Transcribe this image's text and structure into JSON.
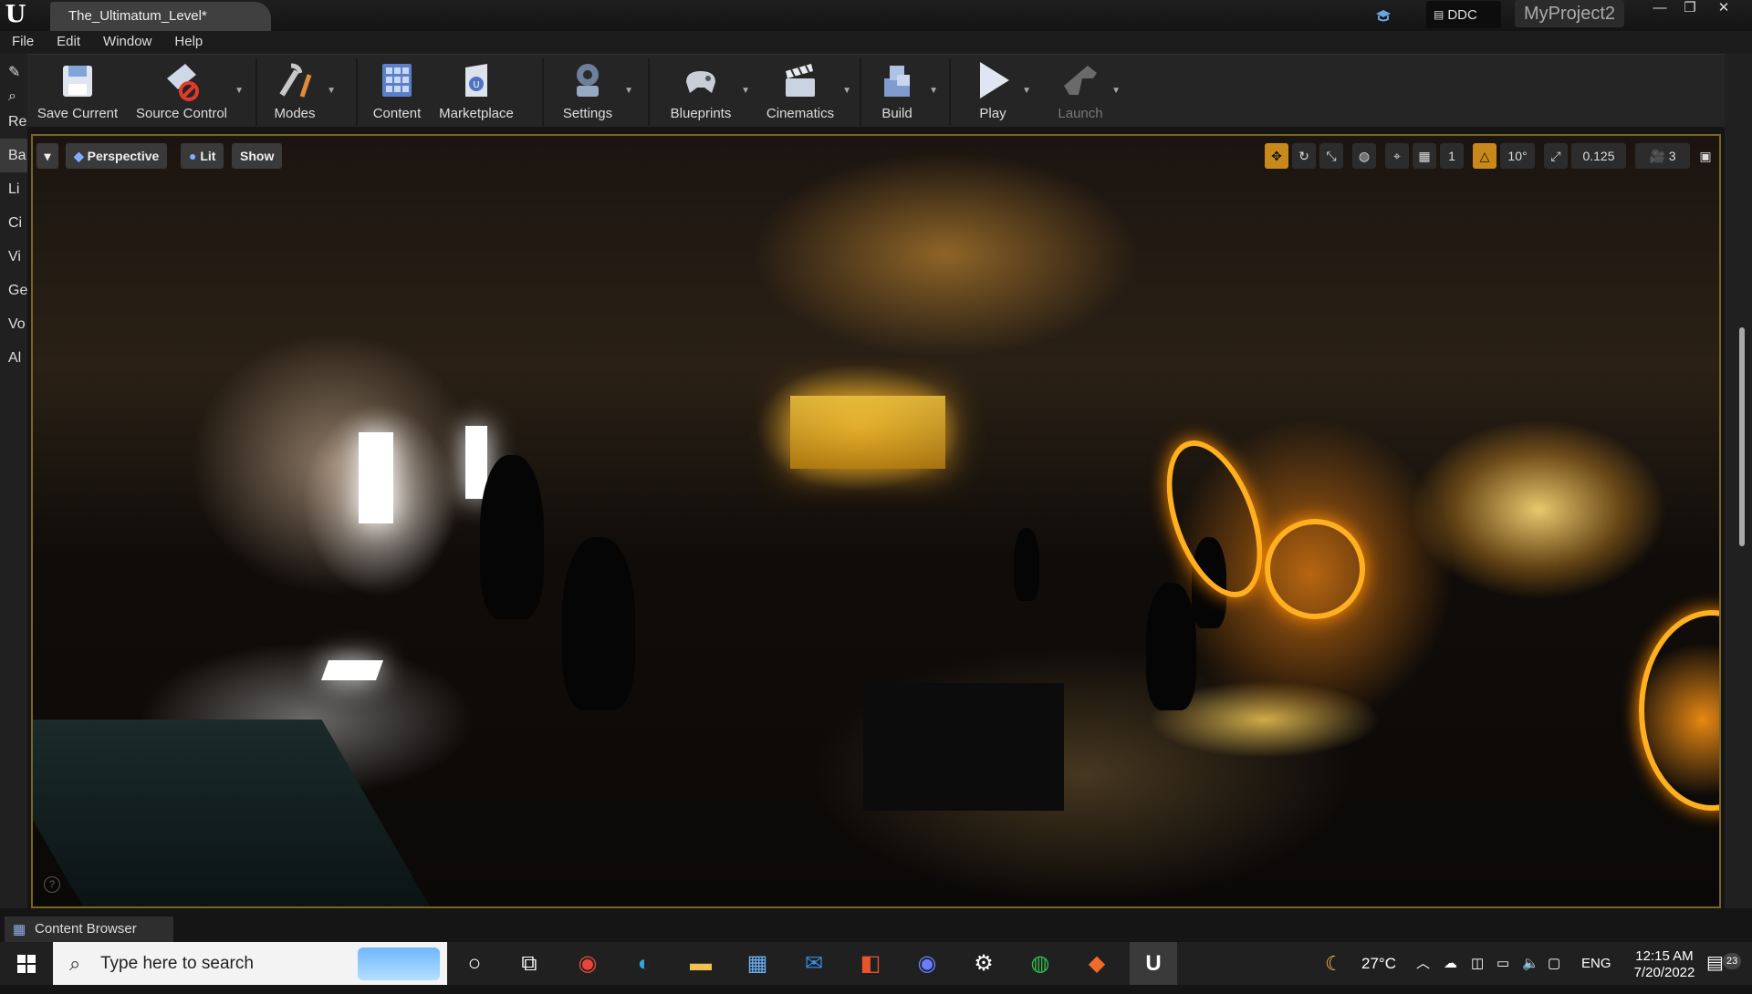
{
  "window": {
    "logo": "U",
    "tab_title": "The_Ultimatum_Level*",
    "ddc_label": "DDC",
    "project_name": "MyProject2"
  },
  "menu": [
    "File",
    "Edit",
    "Window",
    "Help"
  ],
  "toolbar": {
    "save_current": "Save Current",
    "source_control": "Source Control",
    "modes": "Modes",
    "content": "Content",
    "marketplace": "Marketplace",
    "settings": "Settings",
    "blueprints": "Blueprints",
    "cinematics": "Cinematics",
    "build": "Build",
    "play": "Play",
    "launch": "Launch"
  },
  "left_rail": [
    "Re",
    "Ba",
    "Li",
    "Ci",
    "Vi",
    "Ge",
    "Vo",
    "Al"
  ],
  "viewport": {
    "perspective": "Perspective",
    "lit": "Lit",
    "show": "Show",
    "angle_snap": "10°",
    "scale_snap": "0.125",
    "grid_size": "1",
    "camera_speed": "3"
  },
  "content_browser": {
    "tab_label": "Content Browser"
  },
  "taskbar": {
    "search_placeholder": "Type here to search",
    "temperature": "27°C",
    "language": "ENG",
    "time": "12:15 AM",
    "date": "7/20/2022",
    "notifications": "23"
  }
}
